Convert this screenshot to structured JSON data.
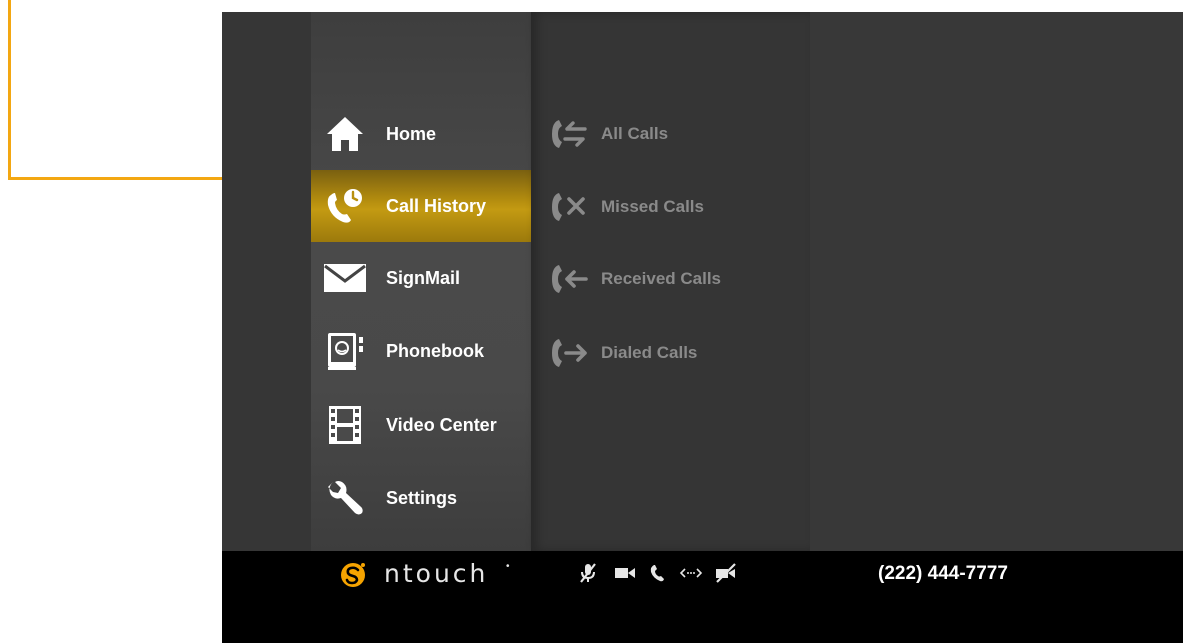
{
  "main_menu": {
    "items": [
      {
        "label": "Home",
        "icon": "home-icon"
      },
      {
        "label": "Call History",
        "icon": "call-history-icon",
        "selected": true
      },
      {
        "label": "SignMail",
        "icon": "envelope-icon"
      },
      {
        "label": "Phonebook",
        "icon": "phonebook-icon"
      },
      {
        "label": "Video Center",
        "icon": "film-icon"
      },
      {
        "label": "Settings",
        "icon": "wrench-icon"
      }
    ]
  },
  "sub_menu": {
    "items": [
      {
        "label": "All Calls",
        "icon": "all-calls-icon"
      },
      {
        "label": "Missed Calls",
        "icon": "missed-calls-icon"
      },
      {
        "label": "Received Calls",
        "icon": "received-calls-icon"
      },
      {
        "label": "Dialed Calls",
        "icon": "dialed-calls-icon"
      }
    ]
  },
  "status_bar": {
    "brand": "ntouch",
    "phone_number": "(222) 444-7777",
    "icons": [
      "mic-muted-icon",
      "video-camera-icon",
      "phone-icon",
      "connection-icon",
      "video-privacy-icon"
    ]
  },
  "colors": {
    "accent": "#f3a712",
    "selected_item": "#b8900f",
    "background": "#363636",
    "status_bar": "#000000",
    "brand_logo": "#f5a300"
  }
}
